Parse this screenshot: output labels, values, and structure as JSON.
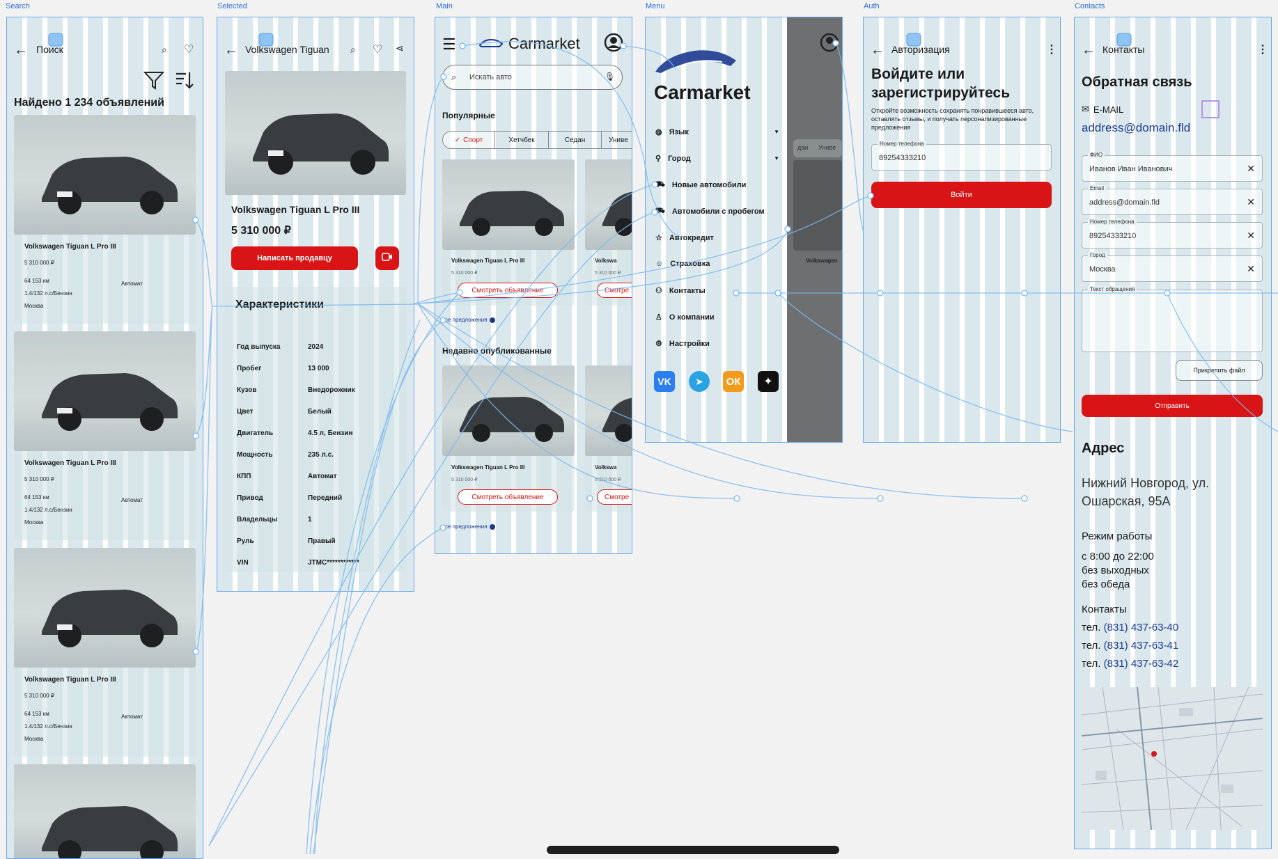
{
  "frame_labels": {
    "search": "Search",
    "selected": "Selected",
    "main": "Main",
    "menu": "Menu",
    "auth": "Auth",
    "contacts": "Contacts"
  },
  "search": {
    "back_title": "Поиск",
    "found": "Найдено 1 234 объявлений",
    "listings": [
      {
        "title": "Volkswagen Tiguan L Pro III",
        "price": "5 310 000 ₽",
        "mileage": "64 153 км",
        "transmission": "Автомат",
        "engine": "1.4/132 л.с/Бензин",
        "city": "Москва"
      },
      {
        "title": "Volkswagen Tiguan L Pro III",
        "price": "5 310 000 ₽",
        "mileage": "64 153 км",
        "transmission": "Автомат",
        "engine": "1.4/132 л.с/Бензин",
        "city": "Москва"
      },
      {
        "title": "Volkswagen Tiguan L Pro III",
        "price": "5 310 000 ₽",
        "mileage": "64 153 км",
        "transmission": "Автомат",
        "engine": "1.4/132 л.с/Бензин",
        "city": "Москва"
      }
    ]
  },
  "selected": {
    "title": "Volkswagen Tiguan",
    "car_name": "Volkswagen Tiguan L Pro III",
    "price": "5 310 000 ₽",
    "write_seller": "Написать продавцу",
    "specs_heading": "Характеристики",
    "specs": [
      {
        "k": "Год выпуска",
        "v": "2024"
      },
      {
        "k": "Пробег",
        "v": "13 000"
      },
      {
        "k": "Кузов",
        "v": "Внедорожник"
      },
      {
        "k": "Цвет",
        "v": "Белый"
      },
      {
        "k": "Двигатель",
        "v": "4.5 л, Бензин"
      },
      {
        "k": "Мощность",
        "v": "235 л.с."
      },
      {
        "k": "КПП",
        "v": "Автомат"
      },
      {
        "k": "Привод",
        "v": "Передний"
      },
      {
        "k": "Владельцы",
        "v": "1"
      },
      {
        "k": "Руль",
        "v": "Правый"
      },
      {
        "k": "VIN",
        "v": "JTMC************"
      }
    ]
  },
  "main": {
    "brand": "Carmarket",
    "search_placeholder": "Искать авто",
    "popular": "Популярные",
    "chips": [
      "Спорт",
      "Хетчбек",
      "Седан",
      "Униве"
    ],
    "card_title": "Volkswagen Tiguan L Pro III",
    "card_title_short": "Volkswa",
    "card_price": "5 310 000 ₽",
    "view_btn": "Смотреть объявление",
    "view_btn_short": "Смотре",
    "all_offers": "се предложения",
    "recent": "Недавно опубликованные"
  },
  "menu": {
    "brand": "Carmarket",
    "items": [
      "Язык",
      "Город",
      "Новые автомобили",
      "Автомобили с пробегом",
      "Автокредит",
      "Страховка",
      "Контакты",
      "О компании",
      "Настройки"
    ],
    "chip_partial": "дан",
    "chip_partial2": "Униве",
    "card_partial": "Volkswagen"
  },
  "auth": {
    "back_title": "Авторизация",
    "heading": "Войдите или зарегистрируйтесь",
    "desc": "Откройте возможность сохранять понравившееся авто, оставлять отзывы, и получать персонализированные предложения",
    "phone_label": "Номер телефона",
    "phone_value": "89254333210",
    "login_btn": "Войти"
  },
  "contacts": {
    "back_title": "Контакты",
    "heading": "Обратная связь",
    "email_label": "E-MAIL",
    "email_link": "address@domain.fld",
    "fields": [
      {
        "label": "ФИО",
        "value": "Иванов Иван Иванович"
      },
      {
        "label": "Email",
        "value": "address@domain.fld"
      },
      {
        "label": "Номер телефона",
        "value": "89254333210"
      },
      {
        "label": "Город",
        "value": "Москва"
      }
    ],
    "message_label": "Текст обращения",
    "attach_btn": "Прикрепить файл",
    "send_btn": "Отправить",
    "address_heading": "Адрес",
    "address": "Нижний Новгород, ул. Ошарская, 95А",
    "hours_heading": "Режим работы",
    "hours": [
      "с 8:00 до 22:00",
      "без выходных",
      "без обеда"
    ],
    "contacts_heading": "Контакты",
    "phones": [
      {
        "prefix": "тел. ",
        "num": "(831) 437-63-40"
      },
      {
        "prefix": "тел. ",
        "num": "(831) 437-63-41"
      },
      {
        "prefix": "тел. ",
        "num": "(831) 437-63-42"
      }
    ]
  },
  "colors": {
    "accent": "#d81416",
    "link": "#1d3a8f",
    "proto_line": "#7ab8f0",
    "frame_border": "#6aa9e8"
  }
}
